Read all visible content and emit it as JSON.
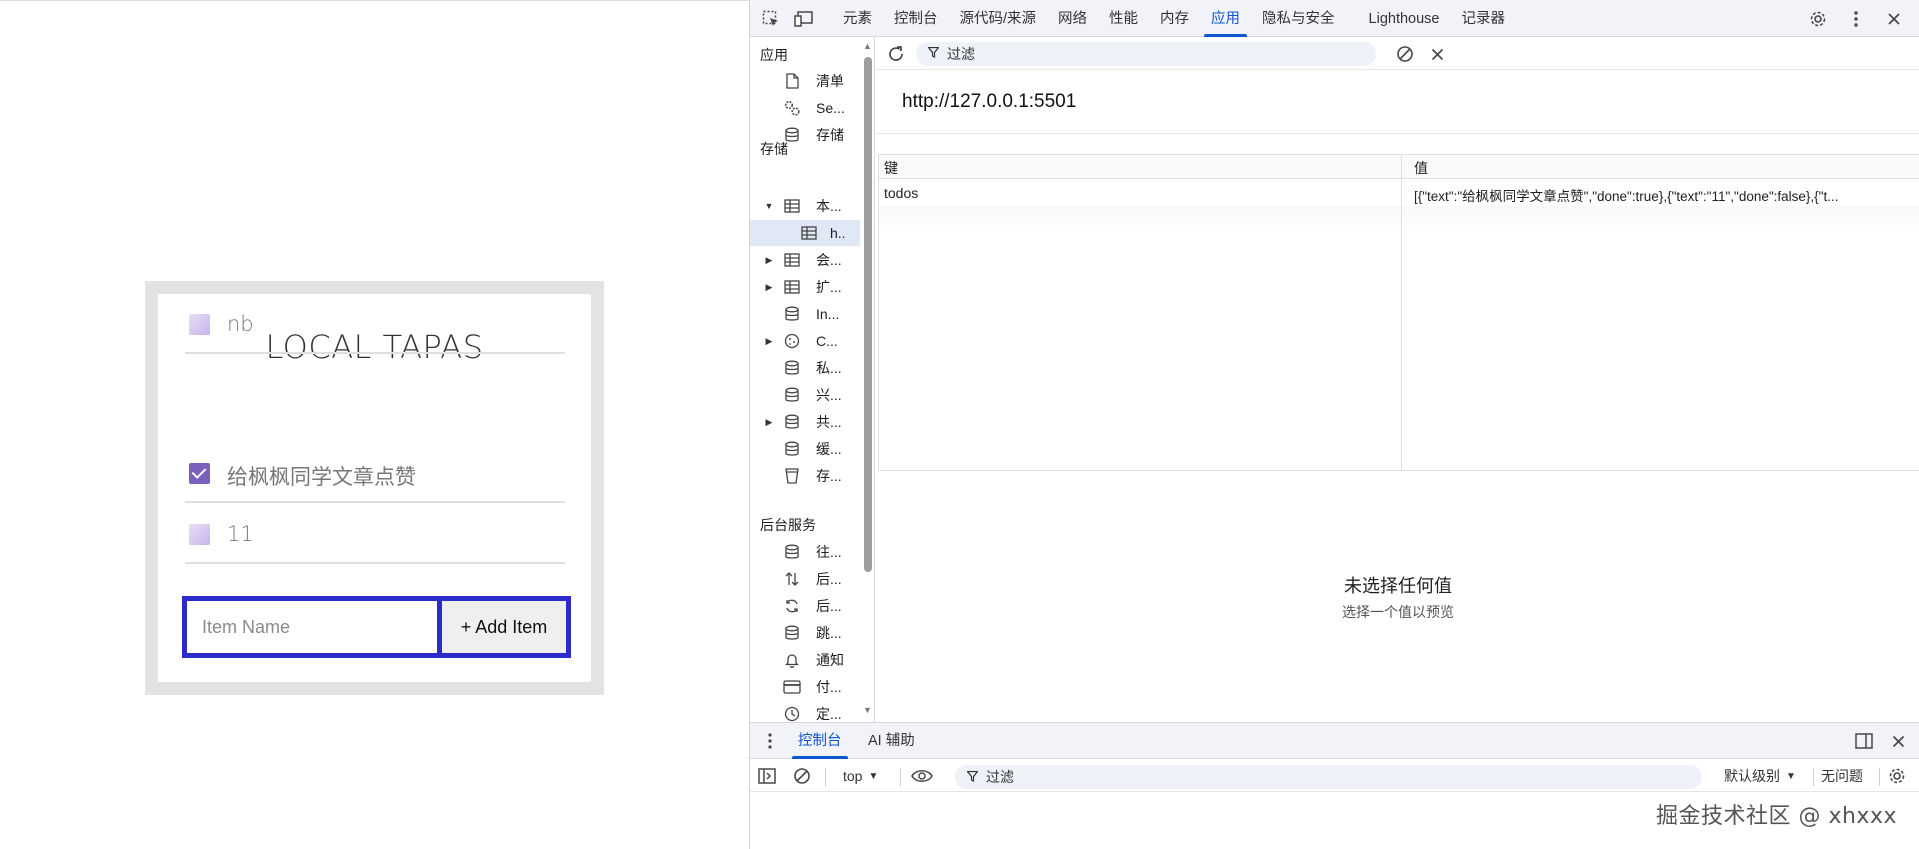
{
  "app": {
    "title": "LOCAL TAPAS",
    "items": [
      {
        "text": "给枫枫同学文章点赞",
        "done": true
      },
      {
        "text": "11",
        "done": false
      },
      {
        "text": "nb",
        "done": false
      }
    ],
    "input_placeholder": "Item Name",
    "add_button": "+ Add Item",
    "colors": {
      "accent_border": "#2b2bcc",
      "check_done": "#7b5fbf"
    }
  },
  "devtools": {
    "tabs": [
      "元素",
      "控制台",
      "源代码/来源",
      "网络",
      "性能",
      "内存",
      "应用",
      "隐私与安全",
      "Lighthouse",
      "记录器"
    ],
    "active_tab": "应用",
    "sidebar": {
      "app_section": "应用",
      "app_items": [
        "清单",
        "Se...",
        "存储"
      ],
      "storage_section": "存储",
      "storage_items": [
        "本...",
        "h..",
        "会...",
        "扩...",
        "In...",
        "C...",
        "私...",
        "兴...",
        "共...",
        "缓...",
        "存..."
      ],
      "bg_section": "后台服务",
      "bg_items": [
        "往...",
        "后...",
        "后...",
        "跳...",
        "通知",
        "付...",
        "定..."
      ]
    },
    "filter_placeholder": "过滤",
    "origin": "http://127.0.0.1:5501",
    "table": {
      "headers": [
        "键",
        "值"
      ],
      "rows": [
        {
          "key": "todos",
          "value": "[{\"text\":\"给枫枫同学文章点赞\",\"done\":true},{\"text\":\"11\",\"done\":false},{\"t..."
        }
      ]
    },
    "preview": {
      "title": "未选择任何值",
      "subtitle": "选择一个值以预览"
    },
    "drawer": {
      "tabs": [
        "控制台",
        "AI 辅助"
      ],
      "context": "top",
      "filter_placeholder": "过滤",
      "level": "默认级别",
      "issues": "无问题"
    }
  },
  "watermark": "掘金技术社区 @ xhxxx"
}
